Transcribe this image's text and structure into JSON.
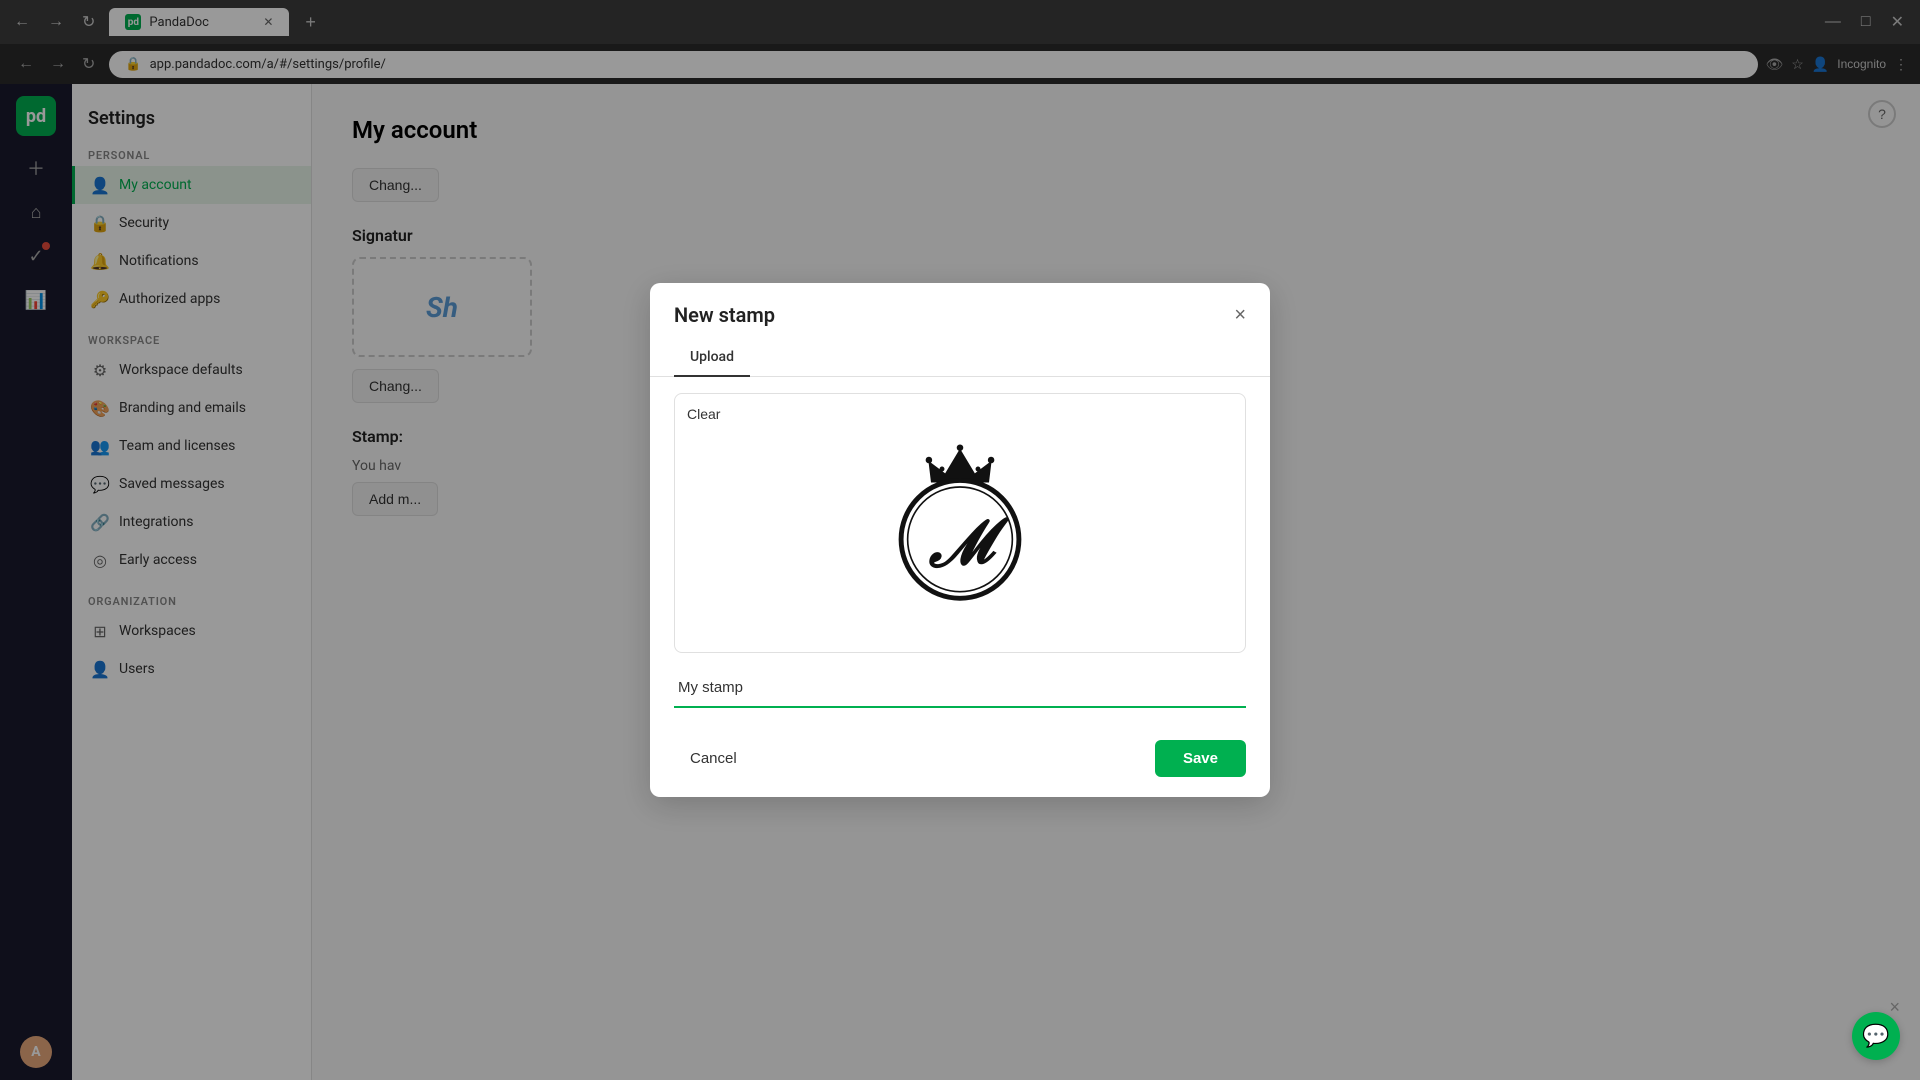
{
  "browser": {
    "tab_title": "PandaDoc",
    "url": "app.pandadoc.com/a/#/settings/profile/",
    "new_tab_label": "+",
    "incognito_label": "Incognito"
  },
  "app": {
    "logo_text": "pd",
    "title": "Settings",
    "help_icon": "?"
  },
  "sidebar": {
    "personal_label": "PERSONAL",
    "workspace_label": "WORKSPACE",
    "organization_label": "ORGANIZATION",
    "items_personal": [
      {
        "id": "my-account",
        "label": "My account",
        "icon": "👤",
        "active": true
      },
      {
        "id": "security",
        "label": "Security",
        "icon": "🔒",
        "active": false
      },
      {
        "id": "notifications",
        "label": "Notifications",
        "icon": "🔔",
        "active": false
      },
      {
        "id": "authorized-apps",
        "label": "Authorized apps",
        "icon": "🔑",
        "active": false
      }
    ],
    "items_workspace": [
      {
        "id": "workspace-defaults",
        "label": "Workspace defaults",
        "icon": "⚙",
        "active": false
      },
      {
        "id": "branding-emails",
        "label": "Branding and emails",
        "icon": "🎨",
        "active": false
      },
      {
        "id": "team-licenses",
        "label": "Team and licenses",
        "icon": "👥",
        "active": false
      },
      {
        "id": "saved-messages",
        "label": "Saved messages",
        "icon": "💬",
        "active": false
      },
      {
        "id": "integrations",
        "label": "Integrations",
        "icon": "🔗",
        "active": false
      },
      {
        "id": "early-access",
        "label": "Early access",
        "icon": "◎",
        "active": false
      }
    ],
    "items_organization": [
      {
        "id": "workspaces",
        "label": "Workspaces",
        "icon": "⊞",
        "active": false
      },
      {
        "id": "users",
        "label": "Users",
        "icon": "👤",
        "active": false
      }
    ]
  },
  "main": {
    "page_title": "My account",
    "signature_section": "Signatur",
    "change_label": "Chang",
    "stamps_section": "Stamp:",
    "stamps_desc": "You hav",
    "add_new_label": "Add m"
  },
  "modal": {
    "title": "New stamp",
    "close_label": "×",
    "tab_upload": "Upload",
    "clear_label": "Clear",
    "stamp_name_value": "My stamp",
    "stamp_name_placeholder": "My stamp",
    "cancel_label": "Cancel",
    "save_label": "Save"
  },
  "chat": {
    "close_label": "×"
  }
}
